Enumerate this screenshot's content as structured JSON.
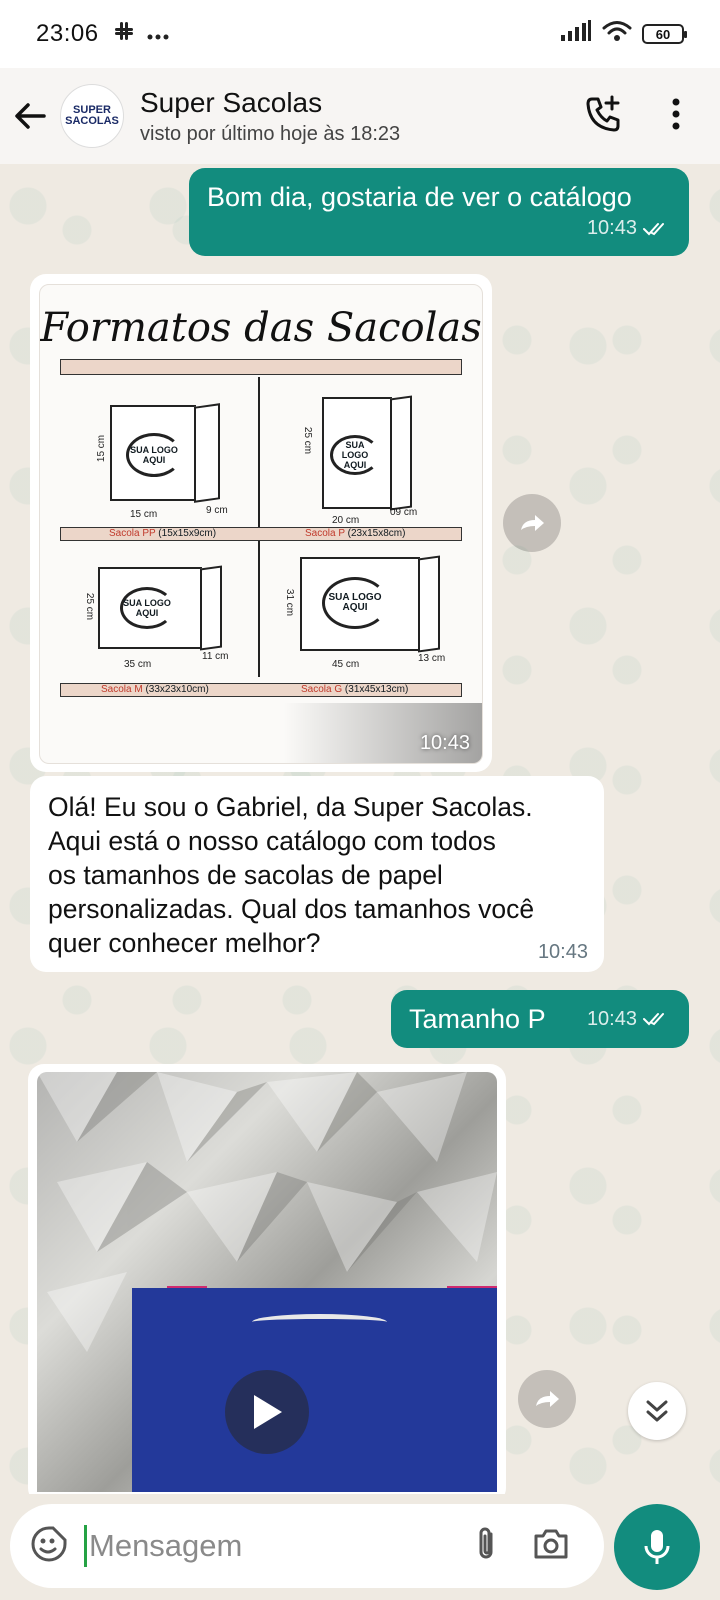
{
  "status_bar": {
    "time": "23:06",
    "battery": "60",
    "icons": [
      "slack-icon",
      "more-dots-icon",
      "signal-icon",
      "wifi-icon",
      "battery-icon"
    ]
  },
  "header": {
    "contact_name": "Super Sacolas",
    "last_seen": "visto por último hoje às 18:23",
    "avatar_text_1": "SUPER",
    "avatar_text_2": "SACOLAS"
  },
  "messages": {
    "m1": {
      "text": "Bom dia, gostaria de ver o catálogo",
      "time": "10:43"
    },
    "catalog": {
      "title": "Formatos das Sacolas",
      "logo_text": "SUA LOGO AQUI",
      "pp": {
        "h": "15 cm",
        "w": "15 cm",
        "d": "9 cm",
        "label": "Sacola PP",
        "size": "(15x15x9cm)"
      },
      "p": {
        "h": "25 cm",
        "w": "20 cm",
        "d": "09 cm",
        "label": "Sacola P",
        "size": "(23x15x8cm)"
      },
      "m": {
        "h": "25 cm",
        "w": "35 cm",
        "d": "11 cm",
        "label": "Sacola M",
        "size": "(33x23x10cm)"
      },
      "g": {
        "h": "31 cm",
        "w": "45 cm",
        "d": "13 cm",
        "label": "Sacola G",
        "size": "(31x45x13cm)"
      },
      "time": "10:43"
    },
    "m3": {
      "lines": [
        "Olá! Eu sou o Gabriel, da Super Sacolas.",
        "Aqui está o nosso catálogo com todos",
        "os tamanhos de sacolas de papel",
        "personalizadas. Qual dos tamanhos você",
        "quer conhecer melhor?"
      ],
      "time": "10:43"
    },
    "m4": {
      "text": "Tamanho P",
      "time": "10:43"
    }
  },
  "input": {
    "placeholder": "Mensagem"
  },
  "colors": {
    "outgoing": "#128c7e",
    "incoming": "#ffffff",
    "background": "#efeae2"
  }
}
